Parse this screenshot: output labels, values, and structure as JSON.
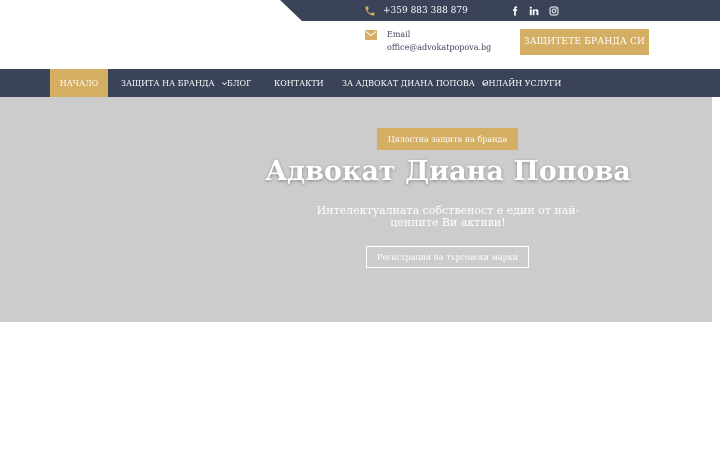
{
  "colors": {
    "navy": "#3b4358",
    "gold": "#d4ae63",
    "hero_bg": "#cccccc",
    "white": "#ffffff"
  },
  "topbar": {
    "phone_icon": "phone-icon",
    "phone": "+359 883 388 879",
    "social": [
      {
        "icon": "facebook-icon"
      },
      {
        "icon": "linkedin-icon"
      },
      {
        "icon": "instagram-icon"
      }
    ]
  },
  "header": {
    "email_icon": "envelope-icon",
    "email_label": "Email",
    "email_value": "office@advokatpopova.bg",
    "cta_label": "ЗАЩИТЕТЕ БРАНДА СИ"
  },
  "nav": {
    "items": [
      {
        "label": "НАЧАЛО",
        "active": true,
        "dropdown": false
      },
      {
        "label": "ЗАЩИТА НА БРАНДА",
        "active": false,
        "dropdown": true
      },
      {
        "label": "БЛОГ",
        "active": false,
        "dropdown": false
      },
      {
        "label": "КОНТАКТИ",
        "active": false,
        "dropdown": false
      },
      {
        "label": "ЗА АДВОКАТ ДИАНА ПОПОВА",
        "active": false,
        "dropdown": true
      },
      {
        "label": "ОНЛАЙН УСЛУГИ",
        "active": false,
        "dropdown": false
      }
    ]
  },
  "hero": {
    "badge": "Цялостна защита на бранда",
    "title": "Адвокат Диана Попова",
    "subtitle": "Интелектуалната собственост е един от най-ценните Ви активи!",
    "button_label": "Регистрация на търговски марки"
  }
}
